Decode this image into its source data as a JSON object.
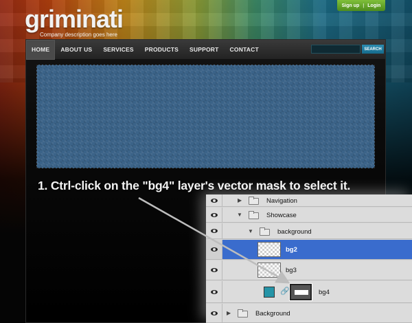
{
  "site": {
    "logo_text": "griminati",
    "tagline": "Company description goes here"
  },
  "account": {
    "signup_label": "Sign up",
    "separator": "|",
    "login_label": "Login"
  },
  "nav": {
    "items": [
      {
        "label": "HOME",
        "active": true
      },
      {
        "label": "ABOUT US",
        "active": false
      },
      {
        "label": "SERVICES",
        "active": false
      },
      {
        "label": "PRODUCTS",
        "active": false
      },
      {
        "label": "SUPPORT",
        "active": false
      },
      {
        "label": "CONTACT",
        "active": false
      }
    ],
    "search_button_label": "SEARCH",
    "search_value": ""
  },
  "instruction": "1. Ctrl-click on the \"bg4\" layer's vector mask to select it.",
  "layers_panel": {
    "rows": [
      {
        "label": "Navigation"
      },
      {
        "label": "Showcase"
      },
      {
        "label": "background"
      },
      {
        "label": "bg2"
      },
      {
        "label": "bg3"
      },
      {
        "label": "bg4"
      },
      {
        "label": "Background"
      }
    ],
    "selected_layer": "bg2"
  },
  "colors": {
    "accent_green": "#5fa52a",
    "selection_blue": "#3a6ccd",
    "showcase_blue": "#3b6388",
    "bg4_fill": "#2594a7"
  }
}
